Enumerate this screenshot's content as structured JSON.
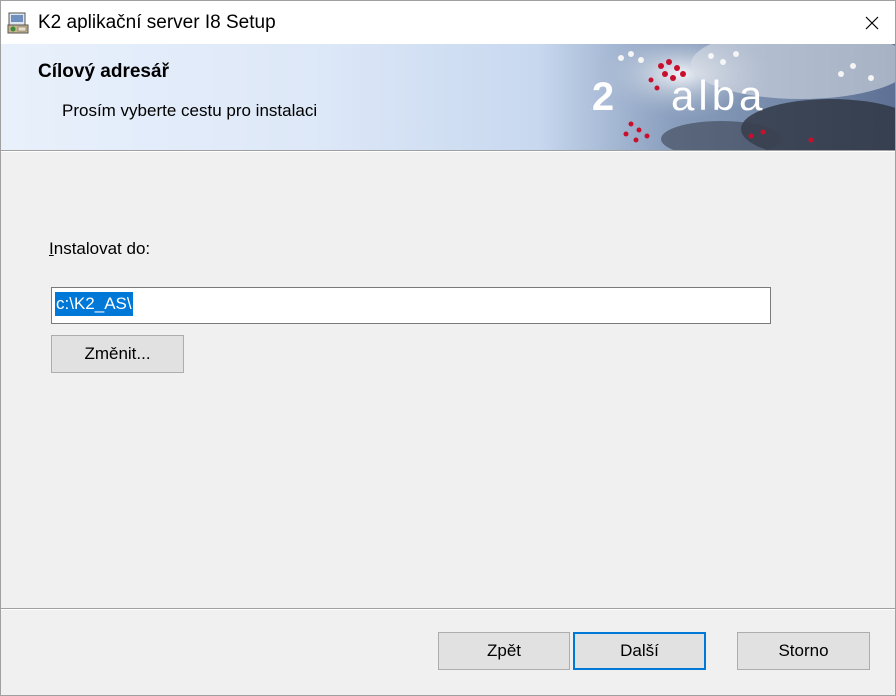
{
  "window": {
    "title": "K2 aplikační server I8 Setup"
  },
  "banner": {
    "title": "Cílový adresář",
    "subtitle": "Prosím vyberte cestu pro instalaci",
    "logo_text": "K2 alba"
  },
  "form": {
    "install_label_accel": "I",
    "install_label_rest": "nstalovat do:",
    "path_value": "c:\\K2_AS\\",
    "change_label": "Změnit..."
  },
  "footer": {
    "back_label": "Zpět",
    "next_label": "Další",
    "cancel_label": "Storno"
  },
  "colors": {
    "selection": "#0078d7",
    "banner_red": "#c8102e",
    "button_face": "#e1e1e1"
  }
}
